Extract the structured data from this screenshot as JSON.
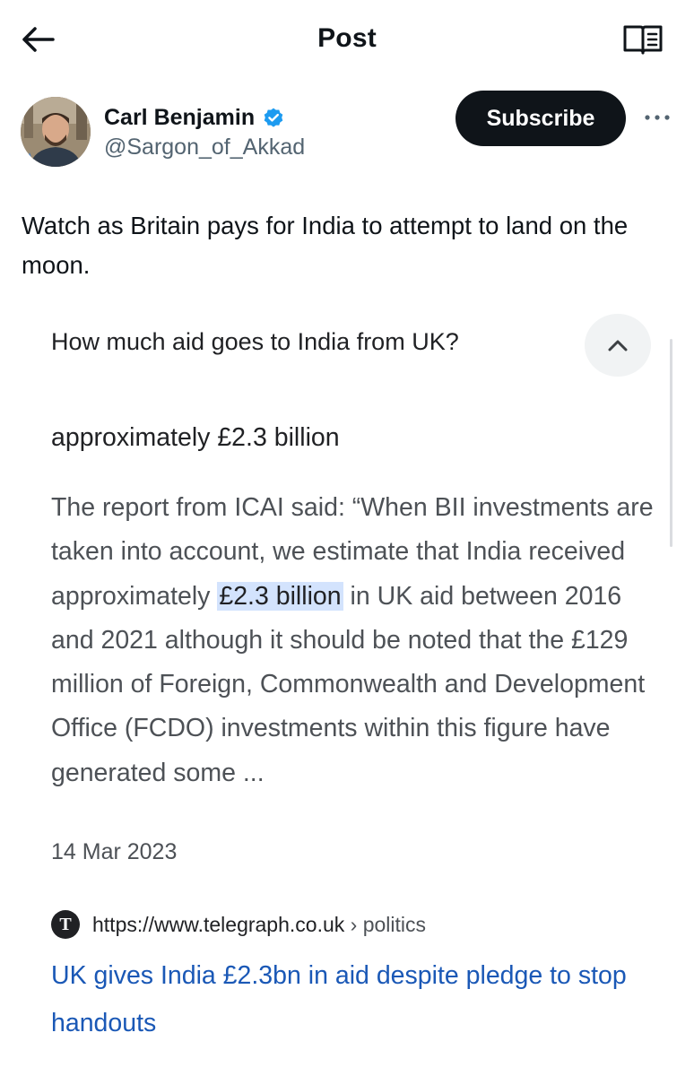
{
  "header": {
    "title": "Post",
    "back_icon": "arrow-left-icon",
    "reader_icon": "book-open-icon"
  },
  "author": {
    "name": "Carl Benjamin",
    "handle": "@Sargon_of_Akkad",
    "verified": true,
    "verified_color": "#1d9bf0",
    "subscribe_label": "Subscribe",
    "more_icon": "more-horizontal-icon"
  },
  "tweet": {
    "text": "Watch as Britain pays for India to attempt to land on the moon."
  },
  "embed": {
    "question": "How much aid goes to India from UK?",
    "answer": "approximately £2.3 billion",
    "snippet_before": "The report from ICAI said: “When BII investments are taken into account, we estimate that India received approximately ",
    "snippet_highlight": "£2.3 billion",
    "snippet_after": " in UK aid between 2016 and 2021 although it should be noted that the £129 million of Foreign, Commonwealth and Development Office (FCDO) investments within this figure have generated some ...",
    "date": "14 Mar 2023",
    "source_url": "https://www.telegraph.co.uk",
    "source_crumb": " › politics",
    "favicon_glyph": "T",
    "result_title": "UK gives India £2.3bn in aid despite pledge to stop handouts"
  }
}
